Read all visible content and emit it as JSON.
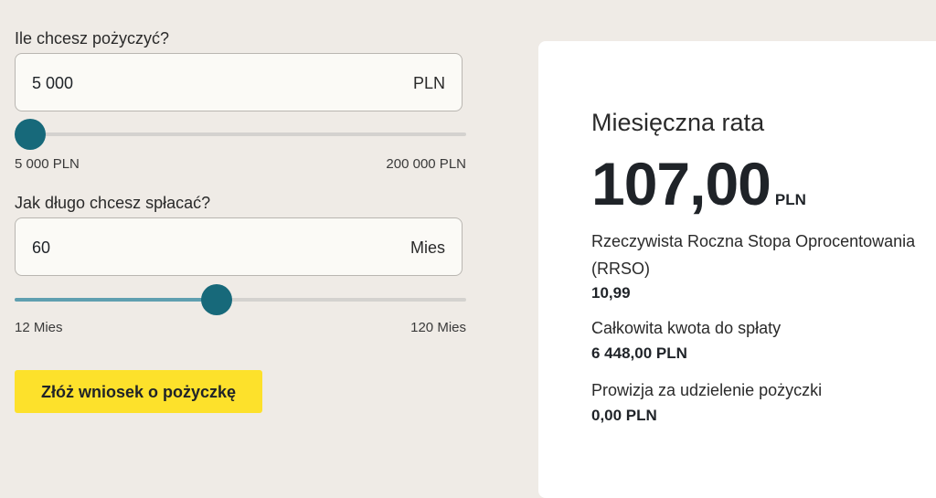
{
  "loan_amount": {
    "label": "Ile chcesz pożyczyć?",
    "value": "5 000",
    "unit": "PLN",
    "min_label": "5 000 PLN",
    "max_label": "200 000 PLN",
    "slider_fraction": 0.0
  },
  "duration": {
    "label": "Jak długo chcesz spłacać?",
    "value": "60",
    "unit": "Mies",
    "min_label": "12 Mies",
    "max_label": "120 Mies",
    "slider_fraction": 0.444
  },
  "apply_button": {
    "label": "Złóż wniosek o pożyczkę"
  },
  "summary": {
    "title": "Miesięczna rata",
    "monthly_amount": "107,00",
    "monthly_unit": "PLN",
    "rrso_label": "Rzeczywista Roczna Stopa Oprocentowania (RRSO)",
    "rrso_value": "10,99",
    "total_label": "Całkowita kwota do spłaty",
    "total_value": "6 448,00 PLN",
    "fee_label": "Prowizja za udzielenie pożyczki",
    "fee_value": "0,00 PLN"
  },
  "colors": {
    "page_background": "#efebe6",
    "slider_thumb": "#17697a",
    "slider_fill": "#5f9fb0",
    "button": "#fde12b"
  }
}
